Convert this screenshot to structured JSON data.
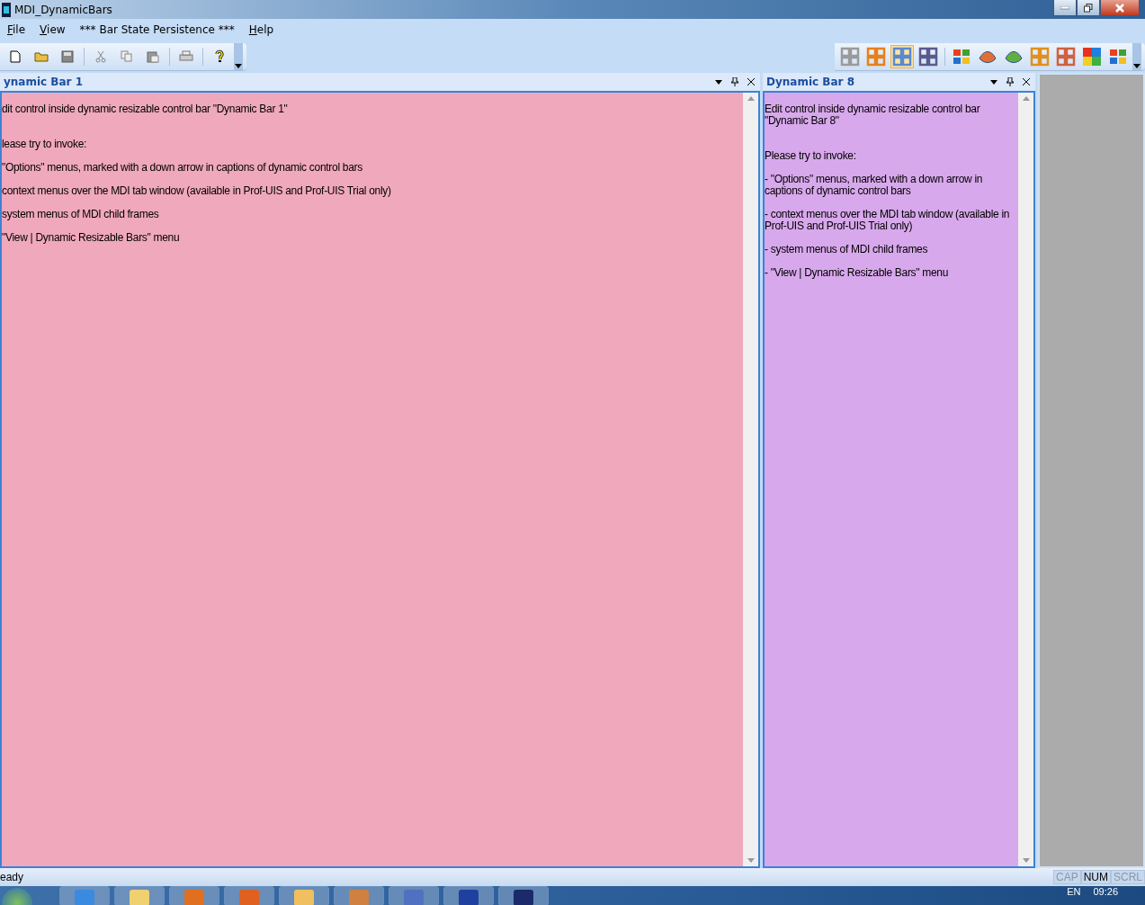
{
  "window": {
    "title": "MDI_DynamicBars"
  },
  "menu": [
    {
      "label": "File",
      "mnemonic": true
    },
    {
      "label": "View",
      "mnemonic": true
    },
    {
      "label": "*** Bar State Persistence ***"
    },
    {
      "label": "Help",
      "mnemonic": true
    }
  ],
  "theme_buttons": [
    {
      "selected": false
    },
    {
      "selected": false
    },
    {
      "selected": true
    },
    {
      "selected": false
    }
  ],
  "panels": [
    {
      "title": "ynamic Bar 1",
      "color": "#f0a8bc",
      "lines": [
        "dit control inside dynamic resizable control bar \"Dynamic Bar 1\"",
        "lease try to invoke:",
        "\"Options\" menus, marked with a down arrow in captions of dynamic control bars",
        "context menus over the MDI tab window (available in Prof-UIS and Prof-UIS Trial only)",
        "system menus of MDI child frames",
        "\"View | Dynamic Resizable Bars\" menu"
      ]
    },
    {
      "title": "Dynamic Bar 8",
      "color": "#d8a8ec",
      "lines": [
        "Edit control inside dynamic resizable control bar \"Dynamic Bar 8\"",
        "Please try to invoke:",
        "- \"Options\" menus, marked with a down arrow in captions of dynamic control bars",
        "- context menus over the MDI tab window (available in Prof-UIS and Prof-UIS Trial only)",
        "- system menus of MDI child frames",
        "- \"View | Dynamic Resizable Bars\" menu"
      ]
    }
  ],
  "status_bar": {
    "text": "eady",
    "indicators": [
      {
        "label": "CAP",
        "on": false
      },
      {
        "label": "NUM",
        "on": true
      },
      {
        "label": "SCRL",
        "on": false
      }
    ]
  },
  "taskbar": {
    "language": "EN",
    "clock": "09:26"
  }
}
